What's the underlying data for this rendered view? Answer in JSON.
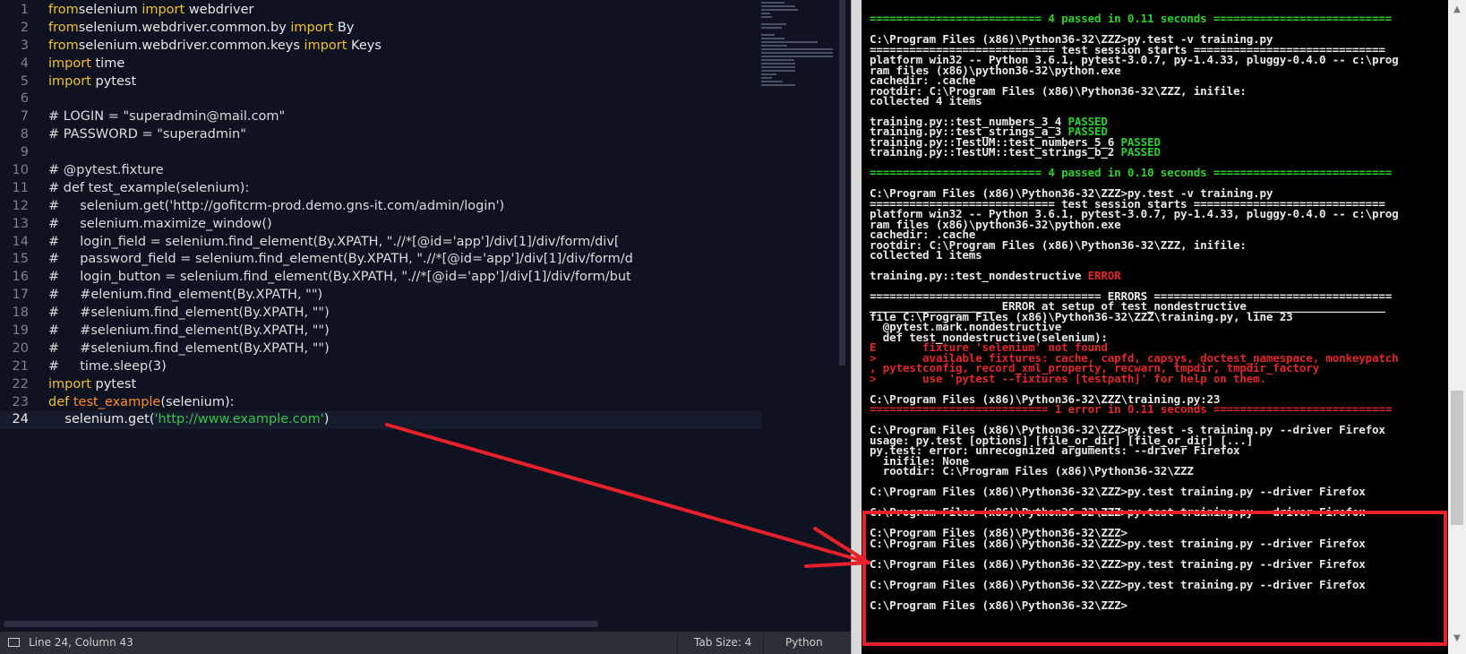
{
  "editor": {
    "lines": [
      {
        "n": "1",
        "tokens": [
          [
            "kw",
            "from"
          ],
          [
            "",
            "selenium "
          ],
          [
            "kw",
            "import"
          ],
          [
            "",
            " webdriver"
          ]
        ]
      },
      {
        "n": "2",
        "tokens": [
          [
            "kw",
            "from"
          ],
          [
            "",
            "selenium.webdriver.common.by "
          ],
          [
            "kw",
            "import"
          ],
          [
            "",
            " By"
          ]
        ]
      },
      {
        "n": "3",
        "tokens": [
          [
            "kw",
            "from"
          ],
          [
            "",
            "selenium.webdriver.common.keys "
          ],
          [
            "kw",
            "import"
          ],
          [
            "",
            " Keys"
          ]
        ]
      },
      {
        "n": "4",
        "tokens": [
          [
            "kw",
            "import"
          ],
          [
            "",
            " time"
          ]
        ]
      },
      {
        "n": "5",
        "tokens": [
          [
            "kw",
            "import"
          ],
          [
            "",
            " pytest"
          ]
        ]
      },
      {
        "n": "6",
        "tokens": []
      },
      {
        "n": "7",
        "tokens": [
          [
            "com",
            "# LOGIN = \"superadmin@mail.com\""
          ]
        ]
      },
      {
        "n": "8",
        "tokens": [
          [
            "com",
            "# PASSWORD = \"superadmin\""
          ]
        ]
      },
      {
        "n": "9",
        "tokens": []
      },
      {
        "n": "10",
        "tokens": [
          [
            "com",
            "# @pytest.fixture"
          ]
        ]
      },
      {
        "n": "11",
        "tokens": [
          [
            "com",
            "# def test_example(selenium):"
          ]
        ]
      },
      {
        "n": "12",
        "tokens": [
          [
            "com",
            "#     selenium.get('http://gofitcrm-prod.demo.gns-it.com/admin/login')"
          ]
        ]
      },
      {
        "n": "13",
        "tokens": [
          [
            "com",
            "#     selenium.maximize_window()"
          ]
        ]
      },
      {
        "n": "14",
        "tokens": [
          [
            "com",
            "#     login_field = selenium.find_element(By.XPATH, \".//*[@id='app']/div[1]/div/form/div["
          ]
        ]
      },
      {
        "n": "15",
        "tokens": [
          [
            "com",
            "#     password_field = selenium.find_element(By.XPATH, \".//*[@id='app']/div[1]/div/form/d"
          ]
        ]
      },
      {
        "n": "16",
        "tokens": [
          [
            "com",
            "#     login_button = selenium.find_element(By.XPATH, \".//*[@id='app']/div[1]/div/form/but"
          ]
        ]
      },
      {
        "n": "17",
        "tokens": [
          [
            "com",
            "#     #elenium.find_element(By.XPATH, \"\")"
          ]
        ]
      },
      {
        "n": "18",
        "tokens": [
          [
            "com",
            "#     #selenium.find_element(By.XPATH, \"\")"
          ]
        ]
      },
      {
        "n": "19",
        "tokens": [
          [
            "com",
            "#     #selenium.find_element(By.XPATH, \"\")"
          ]
        ]
      },
      {
        "n": "20",
        "tokens": [
          [
            "com",
            "#     #selenium.find_element(By.XPATH, \"\")"
          ]
        ]
      },
      {
        "n": "21",
        "tokens": [
          [
            "com",
            "#     time.sleep(3)"
          ]
        ]
      },
      {
        "n": "22",
        "tokens": [
          [
            "kw",
            "import"
          ],
          [
            "",
            " pytest"
          ]
        ]
      },
      {
        "n": "23",
        "tokens": [
          [
            "kw",
            "def"
          ],
          [
            "",
            " "
          ],
          [
            "fn",
            "test_example"
          ],
          [
            "",
            "(selenium):"
          ]
        ]
      },
      {
        "n": "24",
        "tokens": [
          [
            "",
            "    selenium.get("
          ],
          [
            "str",
            "'http://www.example.com'"
          ],
          [
            "",
            ")"
          ]
        ],
        "current": true
      }
    ]
  },
  "statusbar": {
    "position": "Line 24, Column 43",
    "tab_size": "Tab Size: 4",
    "language": "Python"
  },
  "console": {
    "lines": [
      {
        "t": 22,
        "parts": [
          [
            "g",
            "========================== 4 passed in 0.11 seconds ==========================="
          ]
        ]
      },
      {
        "t": 45,
        "parts": [
          [
            "",
            "C:\\Program Files (x86)\\Python36-32\\ZZZ>py.test -v training.py"
          ]
        ]
      },
      {
        "t": 57,
        "parts": [
          [
            "",
            "============================ test session starts ============================="
          ]
        ]
      },
      {
        "t": 68,
        "parts": [
          [
            "",
            "platform win32 -- Python 3.6.1, pytest-3.0.7, py-1.4.33, pluggy-0.4.0 -- c:\\prog"
          ]
        ]
      },
      {
        "t": 80,
        "parts": [
          [
            "",
            "ram files (x86)\\python36-32\\python.exe"
          ]
        ]
      },
      {
        "t": 91,
        "parts": [
          [
            "",
            "cachedir: .cache"
          ]
        ]
      },
      {
        "t": 103,
        "parts": [
          [
            "",
            "rootdir: C:\\Program Files (x86)\\Python36-32\\ZZZ, inifile:"
          ]
        ]
      },
      {
        "t": 114,
        "parts": [
          [
            "",
            "collected 4 items"
          ]
        ]
      },
      {
        "t": 137,
        "parts": [
          [
            "",
            "training.py::test_numbers_3_4 "
          ],
          [
            "g",
            "PASSED"
          ]
        ]
      },
      {
        "t": 148,
        "parts": [
          [
            "",
            "training.py::test_strings_a_3 "
          ],
          [
            "g",
            "PASSED"
          ]
        ]
      },
      {
        "t": 160,
        "parts": [
          [
            "",
            "training.py::TestUM::test_numbers_5_6 "
          ],
          [
            "g",
            "PASSED"
          ]
        ]
      },
      {
        "t": 171,
        "parts": [
          [
            "",
            "training.py::TestUM::test_strings_b_2 "
          ],
          [
            "g",
            "PASSED"
          ]
        ]
      },
      {
        "t": 194,
        "parts": [
          [
            "g",
            "========================== 4 passed in 0.10 seconds ==========================="
          ]
        ]
      },
      {
        "t": 217,
        "parts": [
          [
            "",
            "C:\\Program Files (x86)\\Python36-32\\ZZZ>py.test -v training.py"
          ]
        ]
      },
      {
        "t": 229,
        "parts": [
          [
            "",
            "============================ test session starts ============================="
          ]
        ]
      },
      {
        "t": 240,
        "parts": [
          [
            "",
            "platform win32 -- Python 3.6.1, pytest-3.0.7, py-1.4.33, pluggy-0.4.0 -- c:\\prog"
          ]
        ]
      },
      {
        "t": 252,
        "parts": [
          [
            "",
            "ram files (x86)\\python36-32\\python.exe"
          ]
        ]
      },
      {
        "t": 263,
        "parts": [
          [
            "",
            "cachedir: .cache"
          ]
        ]
      },
      {
        "t": 275,
        "parts": [
          [
            "",
            "rootdir: C:\\Program Files (x86)\\Python36-32\\ZZZ, inifile:"
          ]
        ]
      },
      {
        "t": 286,
        "parts": [
          [
            "",
            "collected 1 items"
          ]
        ]
      },
      {
        "t": 309,
        "parts": [
          [
            "",
            "training.py::test_nondestructive "
          ],
          [
            "r",
            "ERROR"
          ]
        ]
      },
      {
        "t": 332,
        "parts": [
          [
            "",
            "=================================== ERRORS ===================================="
          ]
        ]
      },
      {
        "t": 343,
        "parts": [
          [
            "",
            "___________________ ERROR at setup of test_nondestructive ____________________"
          ]
        ]
      },
      {
        "t": 355,
        "parts": [
          [
            "",
            "file C:\\Program Files (x86)\\Python36-32\\ZZZ\\training.py, line 23"
          ]
        ]
      },
      {
        "t": 366,
        "parts": [
          [
            "",
            "  @pytest.mark.nondestructive"
          ]
        ]
      },
      {
        "t": 378,
        "parts": [
          [
            "",
            "  def test_nondestructive(selenium):"
          ]
        ]
      },
      {
        "t": 389,
        "parts": [
          [
            "r",
            "E       fixture 'selenium' not found"
          ]
        ]
      },
      {
        "t": 401,
        "parts": [
          [
            "r",
            ">       available fixtures: cache, capfd, capsys, doctest_namespace, monkeypatch"
          ]
        ]
      },
      {
        "t": 412,
        "parts": [
          [
            "r",
            ", pytestconfig, record_xml_property, recwarn, tmpdir, tmpdir_factory"
          ]
        ]
      },
      {
        "t": 424,
        "parts": [
          [
            "r",
            ">       use 'pytest --fixtures [testpath]' for help on them."
          ]
        ]
      },
      {
        "t": 447,
        "parts": [
          [
            "",
            "C:\\Program Files (x86)\\Python36-32\\ZZZ\\training.py:23"
          ]
        ]
      },
      {
        "t": 458,
        "parts": [
          [
            "r",
            "=========================== 1 error in 0.11 seconds ==========================="
          ]
        ]
      },
      {
        "t": 481,
        "parts": [
          [
            "",
            "C:\\Program Files (x86)\\Python36-32\\ZZZ>py.test -s training.py --driver Firefox"
          ]
        ]
      },
      {
        "t": 493,
        "parts": [
          [
            "",
            "usage: py.test [options] [file_or_dir] [file_or_dir] [...]"
          ]
        ]
      },
      {
        "t": 504,
        "parts": [
          [
            "",
            "py.test: error: unrecognized arguments: --driver Firefox"
          ]
        ]
      },
      {
        "t": 516,
        "parts": [
          [
            "",
            "  inifile: None"
          ]
        ]
      },
      {
        "t": 527,
        "parts": [
          [
            "",
            "  rootdir: C:\\Program Files (x86)\\Python36-32\\ZZZ"
          ]
        ]
      },
      {
        "t": 550,
        "parts": [
          [
            "",
            "C:\\Program Files (x86)\\Python36-32\\ZZZ>py.test training.py --driver Firefox"
          ]
        ]
      },
      {
        "t": 573,
        "parts": [
          [
            "",
            "C:\\Program Files (x86)\\Python36-32\\ZZZ>py.test training.py --driver Firefox"
          ]
        ]
      },
      {
        "t": 596,
        "parts": [
          [
            "",
            "C:\\Program Files (x86)\\Python36-32\\ZZZ>"
          ]
        ]
      },
      {
        "t": 608,
        "parts": [
          [
            "",
            "C:\\Program Files (x86)\\Python36-32\\ZZZ>py.test training.py --driver Firefox"
          ]
        ]
      },
      {
        "t": 631,
        "parts": [
          [
            "",
            "C:\\Program Files (x86)\\Python36-32\\ZZZ>py.test training.py --driver Firefox"
          ]
        ]
      },
      {
        "t": 654,
        "parts": [
          [
            "",
            "C:\\Program Files (x86)\\Python36-32\\ZZZ>py.test training.py --driver Firefox"
          ]
        ]
      },
      {
        "t": 677,
        "parts": [
          [
            "",
            "C:\\Program Files (x86)\\Python36-32\\ZZZ>"
          ]
        ]
      }
    ]
  },
  "colors": {
    "editor_bg": "#0f1321",
    "keyword": "#f2c22a",
    "function": "#ff8c26",
    "string": "#39c34b",
    "console_pass": "#2cd02c",
    "console_error": "#e0262a",
    "annotation": "#e8202a"
  }
}
